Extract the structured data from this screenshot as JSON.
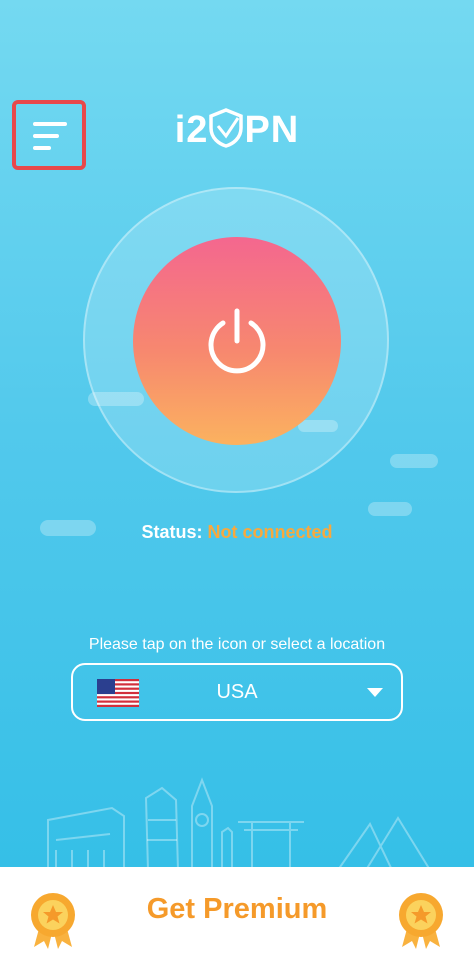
{
  "header": {
    "menu_icon": "hamburger-menu-icon",
    "logo_text_left": "i2",
    "logo_text_right": "PN",
    "logo_icon": "shield-icon"
  },
  "connect": {
    "power_icon": "power-icon",
    "status_label": "Status:",
    "status_value": "Not connected"
  },
  "location": {
    "hint": "Please tap on the icon or select a location",
    "selected": "USA",
    "flag_icon": "us-flag-icon",
    "dropdown_icon": "caret-down-icon"
  },
  "footer": {
    "premium_label": "Get Premium",
    "medal_icon": "medal-star-icon"
  },
  "colors": {
    "accent": "#f59a2a",
    "highlight_border": "#e8484a",
    "button_top": "#f4678f",
    "button_bottom": "#fbb25f",
    "background": "#52c9ec"
  }
}
